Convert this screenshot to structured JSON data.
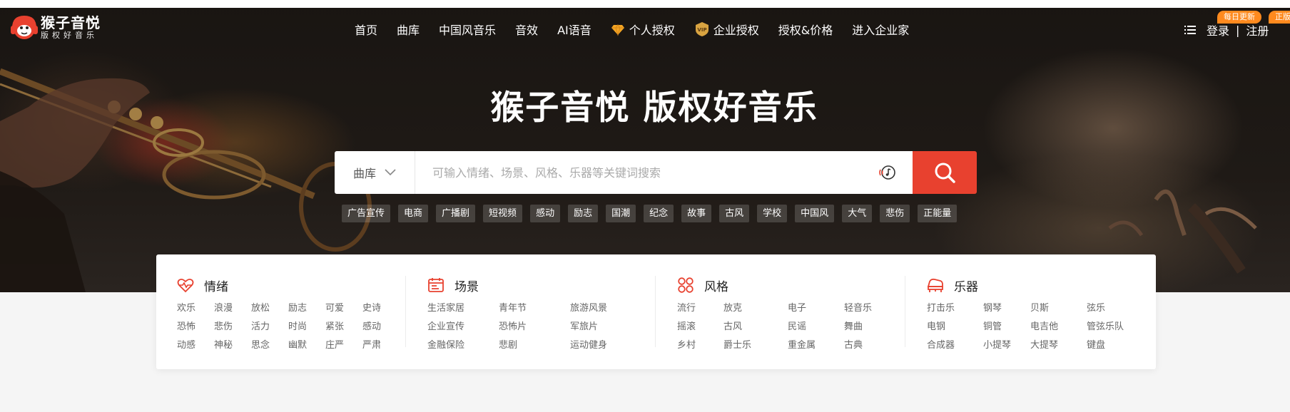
{
  "logo": {
    "title": "猴子音悦",
    "subtitle": "版权好音乐",
    "icon": "monkey-headphones-logo"
  },
  "nav": {
    "items": [
      {
        "label": "首页"
      },
      {
        "label": "曲库"
      },
      {
        "label": "中国风音乐"
      },
      {
        "label": "音效"
      },
      {
        "label": "AI语音"
      },
      {
        "label": "个人授权",
        "icon": "diamond-icon"
      },
      {
        "label": "企业授权",
        "icon": "vip-icon"
      },
      {
        "label": "授权&价格"
      },
      {
        "label": "进入企业家"
      }
    ],
    "login": "登录",
    "separator": "|",
    "register": "注册",
    "badge_daily": "每日更新",
    "badge_genuine": "正版"
  },
  "hero": {
    "headline": "猴子音悦 版权好音乐"
  },
  "search": {
    "category": "曲库",
    "placeholder": "可输入情绪、场景、风格、乐器等关键词搜索"
  },
  "tags": [
    "广告宣传",
    "电商",
    "广播剧",
    "短视频",
    "感动",
    "励志",
    "国潮",
    "纪念",
    "故事",
    "古风",
    "学校",
    "中国风",
    "大气",
    "悲伤",
    "正能量"
  ],
  "categories": [
    {
      "title": "情绪",
      "icon": "heart-pulse-icon",
      "items": [
        "欢乐",
        "浪漫",
        "放松",
        "励志",
        "可爱",
        "史诗",
        "恐怖",
        "悲伤",
        "活力",
        "时尚",
        "紧张",
        "感动",
        "动感",
        "神秘",
        "思念",
        "幽默",
        "庄严",
        "严肃"
      ]
    },
    {
      "title": "场景",
      "icon": "calendar-icon",
      "items": [
        "生活家居",
        "青年节",
        "旅游风景",
        "企业宣传",
        "恐怖片",
        "军旅片",
        "金融保险",
        "悲剧",
        "运动健身"
      ]
    },
    {
      "title": "风格",
      "icon": "grid-circles-icon",
      "items": [
        "流行",
        "放克",
        "电子",
        "轻音乐",
        "摇滚",
        "古风",
        "民谣",
        "舞曲",
        "乡村",
        "爵士乐",
        "重金属",
        "古典"
      ]
    },
    {
      "title": "乐器",
      "icon": "piano-icon",
      "items": [
        "打击乐",
        "钢琴",
        "贝斯",
        "弦乐",
        "电钢",
        "铜管",
        "电吉他",
        "管弦乐队",
        "合成器",
        "小提琴",
        "大提琴",
        "键盘"
      ]
    }
  ],
  "colors": {
    "accent": "#e8412f",
    "badge": "#ff8a1e",
    "nav_bg": "#1a1613"
  }
}
